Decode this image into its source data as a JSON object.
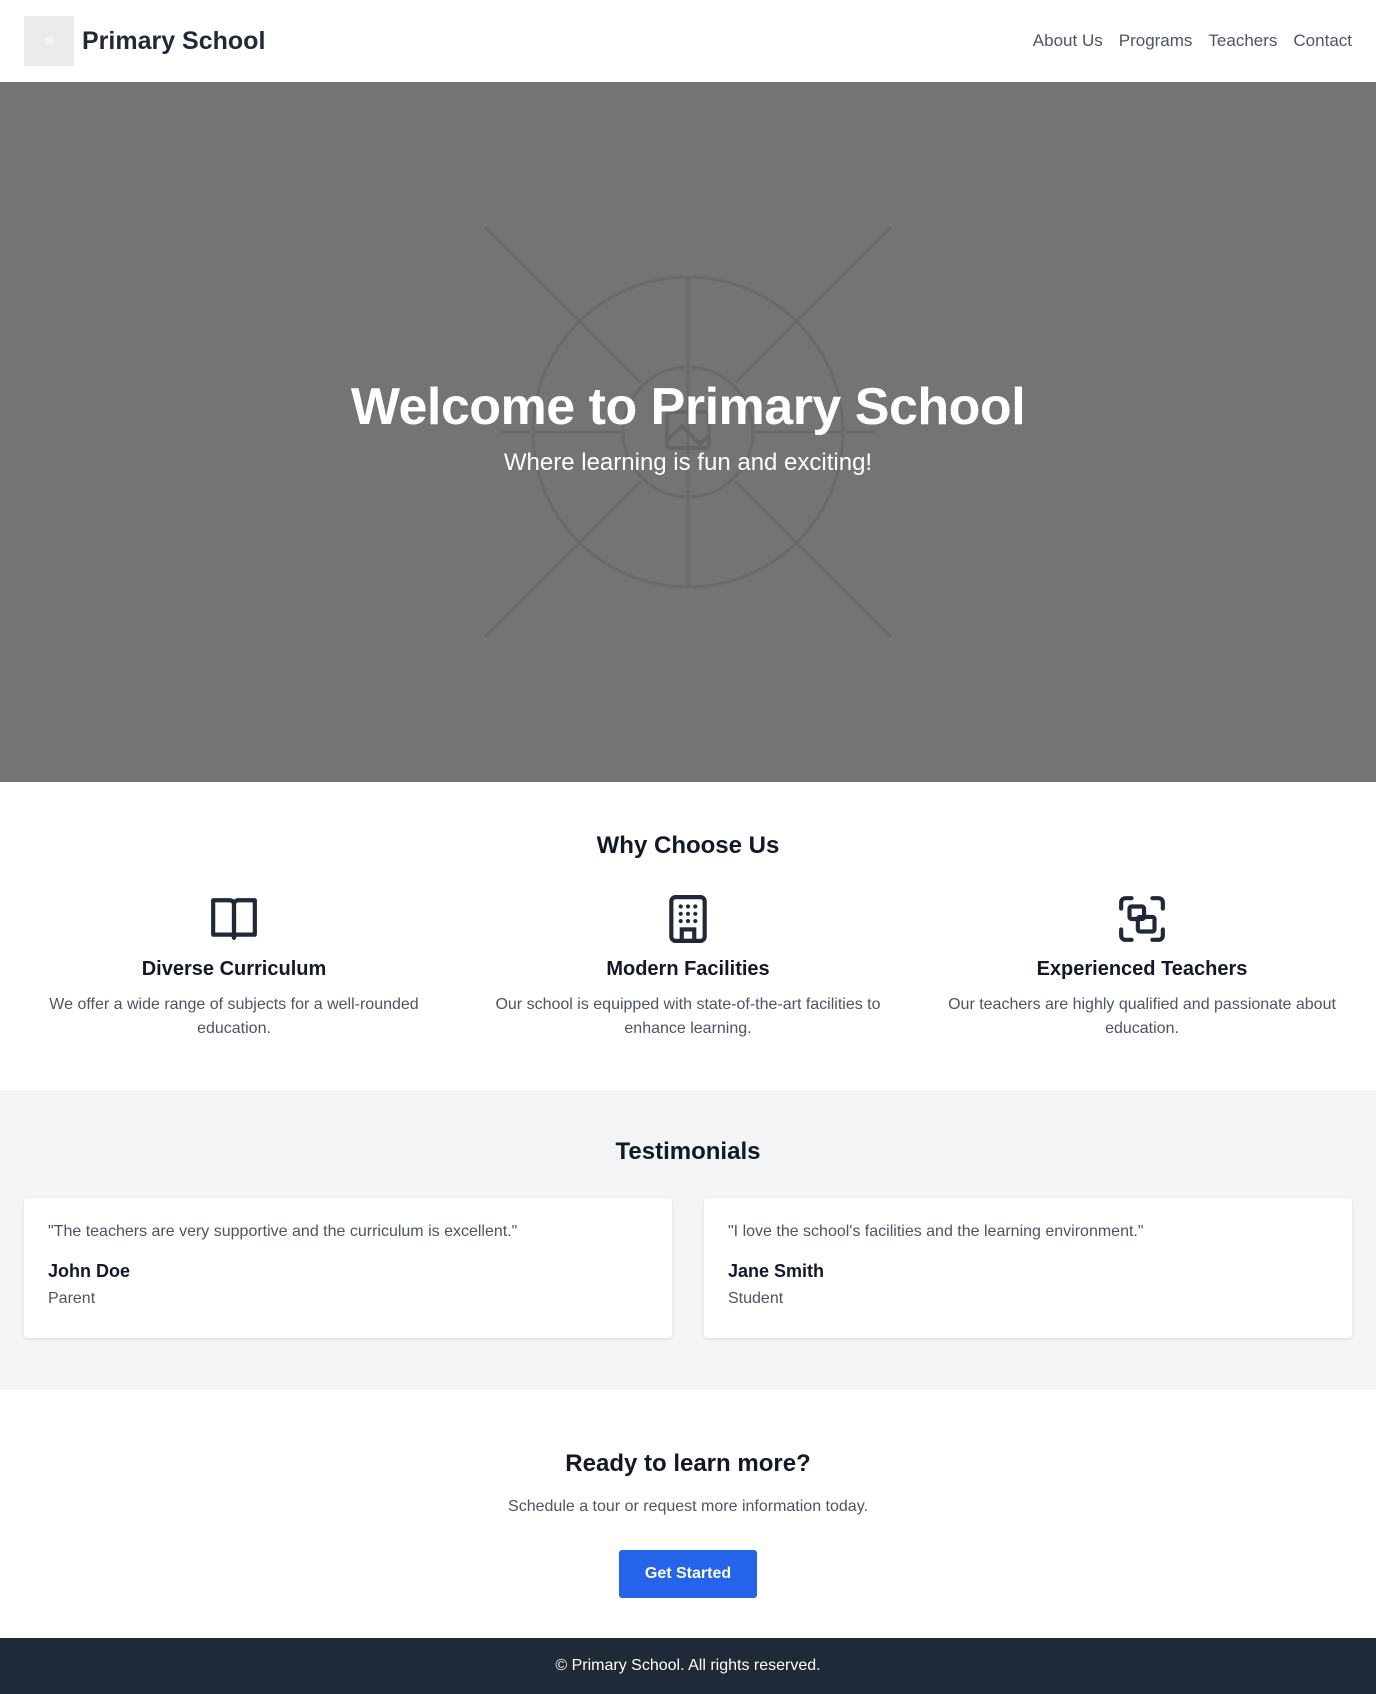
{
  "header": {
    "brand": "Primary School",
    "logo_icon": "school-logo-placeholder",
    "nav": [
      "About Us",
      "Programs",
      "Teachers",
      "Contact"
    ]
  },
  "hero": {
    "title": "Welcome to Primary School",
    "subtitle": "Where learning is fun and exciting!",
    "background_icon": "image-placeholder-icon",
    "background_color": "#747474"
  },
  "why": {
    "title": "Why Choose Us",
    "features": [
      {
        "icon": "book-open-icon",
        "title": "Diverse Curriculum",
        "text": "We offer a wide range of subjects for a well-rounded education."
      },
      {
        "icon": "building-icon",
        "title": "Modern Facilities",
        "text": "Our school is equipped with state-of-the-art facilities to enhance learning."
      },
      {
        "icon": "focus-group-icon",
        "title": "Experienced Teachers",
        "text": "Our teachers are highly qualified and passionate about education."
      }
    ]
  },
  "testimonials": {
    "title": "Testimonials",
    "items": [
      {
        "quote": "\"The teachers are very supportive and the curriculum is excellent.\"",
        "author": "John Doe",
        "role": "Parent"
      },
      {
        "quote": "\"I love the school's facilities and the learning environment.\"",
        "author": "Jane Smith",
        "role": "Student"
      }
    ]
  },
  "cta": {
    "title": "Ready to learn more?",
    "text": "Schedule a tour or request more information today.",
    "button": "Get Started",
    "button_color": "#2563eb"
  },
  "footer": {
    "text": "© Primary School. All rights reserved.",
    "background_color": "#1f2937"
  }
}
